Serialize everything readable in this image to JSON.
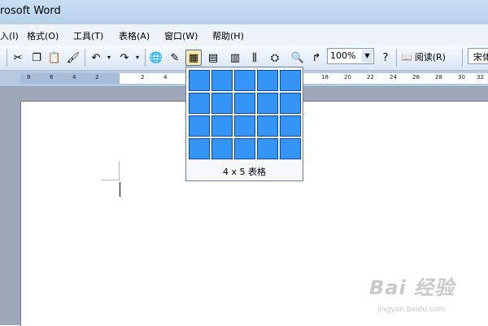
{
  "window": {
    "title": "rosoft Word"
  },
  "menus": [
    {
      "label": "入(I)"
    },
    {
      "label": "格式(O)"
    },
    {
      "label": "工具(T)"
    },
    {
      "label": "表格(A)"
    },
    {
      "label": "窗口(W)"
    },
    {
      "label": "帮助(H)"
    }
  ],
  "toolbar": {
    "zoom": "100%",
    "read_label": "阅读(R)",
    "font": "宋体",
    "icons": [
      "cut-icon",
      "copy-icon",
      "paste-icon",
      "format-painter-icon",
      "undo-icon",
      "redo-icon",
      "hyperlink-icon",
      "tables-borders-icon",
      "insert-table-icon",
      "insert-excel-icon",
      "columns-icon",
      "drawing-icon",
      "document-map-icon",
      "show-hide-icon",
      "help-icon",
      "read-icon"
    ]
  },
  "ruler": {
    "ticks": [
      "8",
      "6",
      "4",
      "2",
      "2",
      "4",
      "18",
      "20",
      "22",
      "24",
      "26",
      "28",
      "30",
      "32"
    ]
  },
  "table_picker": {
    "rows": 4,
    "cols": 5,
    "caption": "4 x 5 表格"
  },
  "watermark": {
    "logo": "Bai 经验",
    "sub": "jingyan.baidu.com"
  },
  "colors": {
    "grid_cell": "#3495f7",
    "grid_border": "#12479a",
    "ruler_band": "#b7c8df",
    "page_bg": "#9fa8b8"
  }
}
